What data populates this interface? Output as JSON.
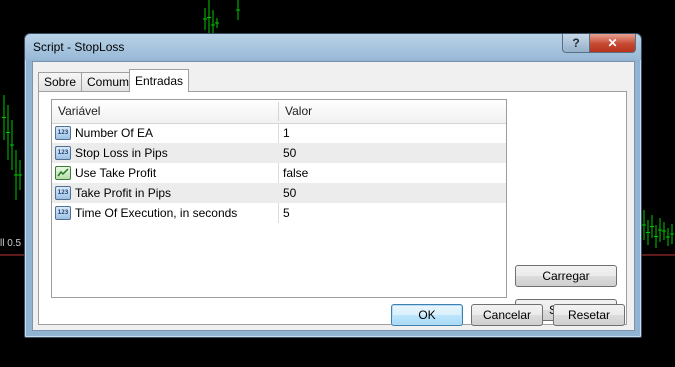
{
  "background": {
    "left_label": "ll 0.5"
  },
  "window": {
    "title": "Script - StopLoss",
    "help_label": "?",
    "close_label": "✕"
  },
  "tabs": [
    {
      "label": "Sobre"
    },
    {
      "label": "Comum"
    },
    {
      "label": "Entradas",
      "active": true
    }
  ],
  "grid": {
    "columns": [
      "Variável",
      "Valor"
    ],
    "rows": [
      {
        "icon": "123",
        "name": "Number Of EA",
        "value": "1"
      },
      {
        "icon": "bool",
        "name": "Stop Loss in Pips",
        "value": "50"
      },
      {
        "icon": "bool",
        "name": "Use Take Profit",
        "value": "false"
      },
      {
        "icon": "123",
        "name": "Take Profit in Pips",
        "value": "50"
      },
      {
        "icon": "123",
        "name": "Time Of Execution, in seconds",
        "value": "5"
      }
    ]
  },
  "side_buttons": {
    "load": "Carregar",
    "save": "Salvar"
  },
  "footer_buttons": {
    "ok": "OK",
    "cancel": "Cancelar",
    "reset": "Resetar"
  }
}
